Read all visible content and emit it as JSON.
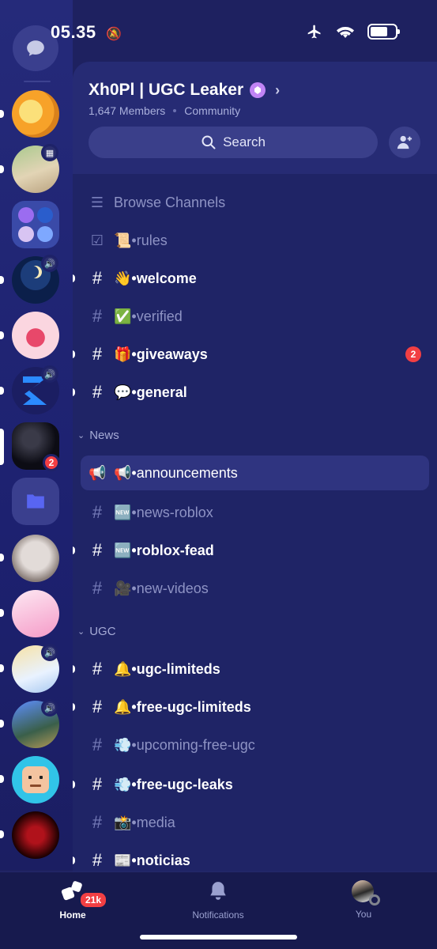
{
  "status": {
    "time": "05.35"
  },
  "rail": {
    "servers": [
      {
        "name": "server-1",
        "badge": "",
        "colors": [
          "#f7a229",
          "#f4d03f"
        ]
      },
      {
        "name": "server-2",
        "badge": "event",
        "colors": [
          "#7ea86a",
          "#d9c7a5"
        ]
      },
      {
        "name": "server-3",
        "badge": "",
        "colors": [
          "#3a4aa8",
          "#8aa0ff"
        ],
        "folder": true
      },
      {
        "name": "server-4",
        "badge": "voice",
        "colors": [
          "#0f2a5a",
          "#1b3d7a"
        ],
        "caption": "Ramadan Kareem"
      },
      {
        "name": "server-5",
        "badge": "",
        "colors": [
          "#f5c6d2",
          "#e8486a"
        ]
      },
      {
        "name": "server-6",
        "badge": "voice",
        "colors": [
          "#1b1e62",
          "#2b7bff"
        ]
      },
      {
        "name": "server-7",
        "badge": "2",
        "colors": [
          "#0c0c14",
          "#2a2a38"
        ]
      },
      {
        "name": "folder",
        "badge": "",
        "colors": [
          "#3a3f8e",
          "#3a3f8e"
        ]
      },
      {
        "name": "server-9",
        "badge": "",
        "colors": [
          "#cfc7c4",
          "#8b7f7a"
        ]
      },
      {
        "name": "server-10",
        "badge": "",
        "colors": [
          "#fbd6ea",
          "#f59ac7"
        ]
      },
      {
        "name": "server-11",
        "badge": "voice",
        "colors": [
          "#e9f2ff",
          "#f7e2a5"
        ]
      },
      {
        "name": "server-12",
        "badge": "voice",
        "colors": [
          "#3a5f4a",
          "#5e8fff"
        ]
      },
      {
        "name": "server-13",
        "badge": "",
        "colors": [
          "#31c4e8",
          "#f3c4a0"
        ]
      },
      {
        "name": "server-14",
        "badge": "",
        "colors": [
          "#1a0000",
          "#b0121b"
        ]
      }
    ]
  },
  "header": {
    "server_name": "Xh0Pl | UGC Leaker",
    "members": "1,647 Members",
    "type": "Community",
    "search_label": "Search"
  },
  "channels": {
    "browse": "Browse Channels",
    "rules": "📜•rules",
    "welcome": "👋•welcome",
    "verified": "✅•verified",
    "giveaways": "🎁•giveaways",
    "giveaways_mentions": "2",
    "general": "💬•general",
    "cat_news": "News",
    "announcements": "📢•announcements",
    "news_roblox": "🆕•news-roblox",
    "roblox_fead": "🆕•roblox-fead",
    "new_videos": "🎥•new-videos",
    "cat_ugc": "UGC",
    "ugc_limiteds": "🔔•ugc-limiteds",
    "free_ugc_limiteds": "🔔•free-ugc-limiteds",
    "upcoming_free_ugc": "💨•upcoming-free-ugc",
    "free_ugc_leaks": "💨•free-ugc-leaks",
    "media": "📸•media",
    "noticias": "📰•noticias"
  },
  "nav": {
    "home": "Home",
    "home_badge": "21k",
    "notifications": "Notifications",
    "you": "You"
  },
  "colors": {
    "accent_red": "#f23f43",
    "panel": "#1f2466",
    "rail": "#1d2170"
  }
}
